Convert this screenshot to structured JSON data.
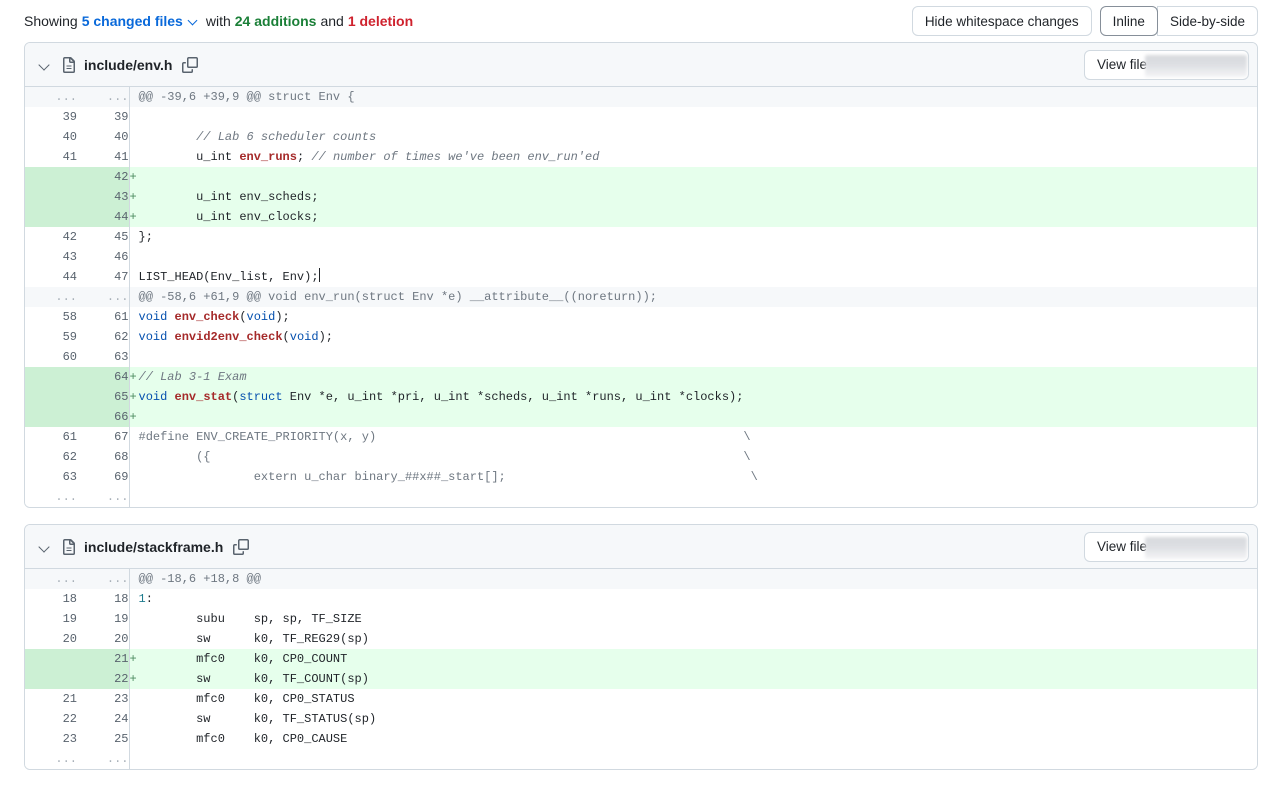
{
  "toolbar": {
    "showing_label": "Showing",
    "changed_files_link": "5 changed files",
    "caret_icon": "chevron-down-icon",
    "with_label": "with",
    "additions": "24 additions",
    "and_label": "and",
    "deletions": "1 deletion",
    "hide_whitespace_label": "Hide whitespace changes",
    "inline_label": "Inline",
    "side_by_side_label": "Side-by-side",
    "selected_view": "Inline"
  },
  "colors": {
    "link": "#0969da",
    "addition": "#1a7f37",
    "deletion": "#cf222e",
    "add_bg": "#e6ffec",
    "add_gutter_bg": "#ccf0d4",
    "hunk_bg": "#f6f8fa",
    "border": "#d1d9e0"
  },
  "files": [
    {
      "name": "include/env.h",
      "chevron_icon": "chevron-down-icon",
      "file_icon": "file-icon",
      "copy_icon": "copy-to-clipboard-icon",
      "view_file_label": "View file",
      "view_file_suffix": "(",
      "rows": [
        {
          "type": "hunk",
          "old": "...",
          "new": "...",
          "marker": " ",
          "segments": [
            {
              "cls": "pp",
              "t": "@@ -39,6 +39,9 @@ struct Env {"
            }
          ]
        },
        {
          "type": "ctx",
          "old": "39",
          "new": "39",
          "marker": " ",
          "segments": [
            {
              "cls": "tx",
              "t": ""
            }
          ]
        },
        {
          "type": "ctx",
          "old": "40",
          "new": "40",
          "marker": " ",
          "segments": [
            {
              "cls": "cm",
              "t": "        // Lab 6 scheduler counts"
            }
          ]
        },
        {
          "type": "ctx",
          "old": "41",
          "new": "41",
          "marker": " ",
          "segments": [
            {
              "cls": "tx",
              "t": "        u_int "
            },
            {
              "cls": "fn",
              "t": "env_runs"
            },
            {
              "cls": "tx",
              "t": "; "
            },
            {
              "cls": "cm",
              "t": "// number of times we've been env_run'ed"
            }
          ]
        },
        {
          "type": "add",
          "old": "",
          "new": "42",
          "marker": "+",
          "segments": [
            {
              "cls": "tx",
              "t": ""
            }
          ]
        },
        {
          "type": "add",
          "old": "",
          "new": "43",
          "marker": "+",
          "segments": [
            {
              "cls": "tx",
              "t": "        u_int env_scheds;"
            }
          ]
        },
        {
          "type": "add",
          "old": "",
          "new": "44",
          "marker": "+",
          "segments": [
            {
              "cls": "tx",
              "t": "        u_int env_clocks;"
            }
          ]
        },
        {
          "type": "ctx",
          "old": "42",
          "new": "45",
          "marker": " ",
          "segments": [
            {
              "cls": "tx",
              "t": "};"
            }
          ]
        },
        {
          "type": "ctx",
          "old": "43",
          "new": "46",
          "marker": " ",
          "segments": [
            {
              "cls": "tx",
              "t": ""
            }
          ]
        },
        {
          "type": "ctx",
          "old": "44",
          "new": "47",
          "marker": " ",
          "segments": [
            {
              "cls": "tx",
              "t": "LIST_HEAD(Env_list, Env);"
            },
            {
              "cls": "caret",
              "t": ""
            }
          ]
        },
        {
          "type": "hunk",
          "old": "...",
          "new": "...",
          "marker": " ",
          "segments": [
            {
              "cls": "pp",
              "t": "@@ -58,6 +61,9 @@ void env_run(struct Env *e) __attribute__((noreturn));"
            }
          ]
        },
        {
          "type": "ctx",
          "old": "58",
          "new": "61",
          "marker": " ",
          "segments": [
            {
              "cls": "k",
              "t": "void"
            },
            {
              "cls": "tx",
              "t": " "
            },
            {
              "cls": "fn",
              "t": "env_check"
            },
            {
              "cls": "tx",
              "t": "("
            },
            {
              "cls": "k",
              "t": "void"
            },
            {
              "cls": "tx",
              "t": ");"
            }
          ]
        },
        {
          "type": "ctx",
          "old": "59",
          "new": "62",
          "marker": " ",
          "segments": [
            {
              "cls": "k",
              "t": "void"
            },
            {
              "cls": "tx",
              "t": " "
            },
            {
              "cls": "fn",
              "t": "envid2env_check"
            },
            {
              "cls": "tx",
              "t": "("
            },
            {
              "cls": "k",
              "t": "void"
            },
            {
              "cls": "tx",
              "t": ");"
            }
          ]
        },
        {
          "type": "ctx",
          "old": "60",
          "new": "63",
          "marker": " ",
          "segments": [
            {
              "cls": "tx",
              "t": ""
            }
          ]
        },
        {
          "type": "add",
          "old": "",
          "new": "64",
          "marker": "+",
          "segments": [
            {
              "cls": "cm",
              "t": "// Lab 3-1 Exam"
            }
          ]
        },
        {
          "type": "add",
          "old": "",
          "new": "65",
          "marker": "+",
          "segments": [
            {
              "cls": "k",
              "t": "void"
            },
            {
              "cls": "tx",
              "t": " "
            },
            {
              "cls": "fn",
              "t": "env_stat"
            },
            {
              "cls": "tx",
              "t": "("
            },
            {
              "cls": "k",
              "t": "struct"
            },
            {
              "cls": "tx",
              "t": " Env *e, u_int *pri, u_int *scheds, u_int *runs, u_int *clocks);"
            }
          ]
        },
        {
          "type": "add",
          "old": "",
          "new": "66",
          "marker": "+",
          "segments": [
            {
              "cls": "tx",
              "t": ""
            }
          ]
        },
        {
          "type": "ctx",
          "old": "61",
          "new": "67",
          "marker": " ",
          "segments": [
            {
              "cls": "pp",
              "t": "#define ENV_CREATE_PRIORITY(x, y)                                                   \\"
            }
          ]
        },
        {
          "type": "ctx",
          "old": "62",
          "new": "68",
          "marker": " ",
          "segments": [
            {
              "cls": "pp",
              "t": "        ({                                                                          \\"
            }
          ]
        },
        {
          "type": "ctx",
          "old": "63",
          "new": "69",
          "marker": " ",
          "segments": [
            {
              "cls": "pp",
              "t": "                extern u_char binary_##x##_start[];                                  \\"
            }
          ]
        },
        {
          "type": "expander",
          "old": "...",
          "new": "...",
          "marker": " ",
          "segments": [
            {
              "cls": "tx",
              "t": ""
            }
          ]
        }
      ]
    },
    {
      "name": "include/stackframe.h",
      "chevron_icon": "chevron-down-icon",
      "file_icon": "file-icon",
      "copy_icon": "copy-to-clipboard-icon",
      "view_file_label": "View file",
      "view_file_suffix": "(",
      "rows": [
        {
          "type": "hunk",
          "old": "...",
          "new": "...",
          "marker": " ",
          "segments": [
            {
              "cls": "pp",
              "t": "@@ -18,6 +18,8 @@"
            }
          ]
        },
        {
          "type": "ctx",
          "old": "18",
          "new": "18",
          "marker": " ",
          "segments": [
            {
              "cls": "lb",
              "t": "1"
            },
            {
              "cls": "tx",
              "t": ":"
            }
          ]
        },
        {
          "type": "ctx",
          "old": "19",
          "new": "19",
          "marker": " ",
          "segments": [
            {
              "cls": "tx",
              "t": "        subu    sp, sp, TF_SIZE"
            }
          ]
        },
        {
          "type": "ctx",
          "old": "20",
          "new": "20",
          "marker": " ",
          "segments": [
            {
              "cls": "tx",
              "t": "        sw      k0, TF_REG29(sp)"
            }
          ]
        },
        {
          "type": "add",
          "old": "",
          "new": "21",
          "marker": "+",
          "segments": [
            {
              "cls": "tx",
              "t": "        mfc0    k0, CP0_COUNT"
            }
          ]
        },
        {
          "type": "add",
          "old": "",
          "new": "22",
          "marker": "+",
          "segments": [
            {
              "cls": "tx",
              "t": "        sw      k0, TF_COUNT(sp)"
            }
          ]
        },
        {
          "type": "ctx",
          "old": "21",
          "new": "23",
          "marker": " ",
          "segments": [
            {
              "cls": "tx",
              "t": "        mfc0    k0, CP0_STATUS"
            }
          ]
        },
        {
          "type": "ctx",
          "old": "22",
          "new": "24",
          "marker": " ",
          "segments": [
            {
              "cls": "tx",
              "t": "        sw      k0, TF_STATUS(sp)"
            }
          ]
        },
        {
          "type": "ctx",
          "old": "23",
          "new": "25",
          "marker": " ",
          "segments": [
            {
              "cls": "tx",
              "t": "        mfc0    k0, CP0_CAUSE"
            }
          ]
        },
        {
          "type": "expander",
          "old": "...",
          "new": "...",
          "marker": " ",
          "segments": [
            {
              "cls": "tx",
              "t": ""
            }
          ]
        }
      ]
    }
  ]
}
